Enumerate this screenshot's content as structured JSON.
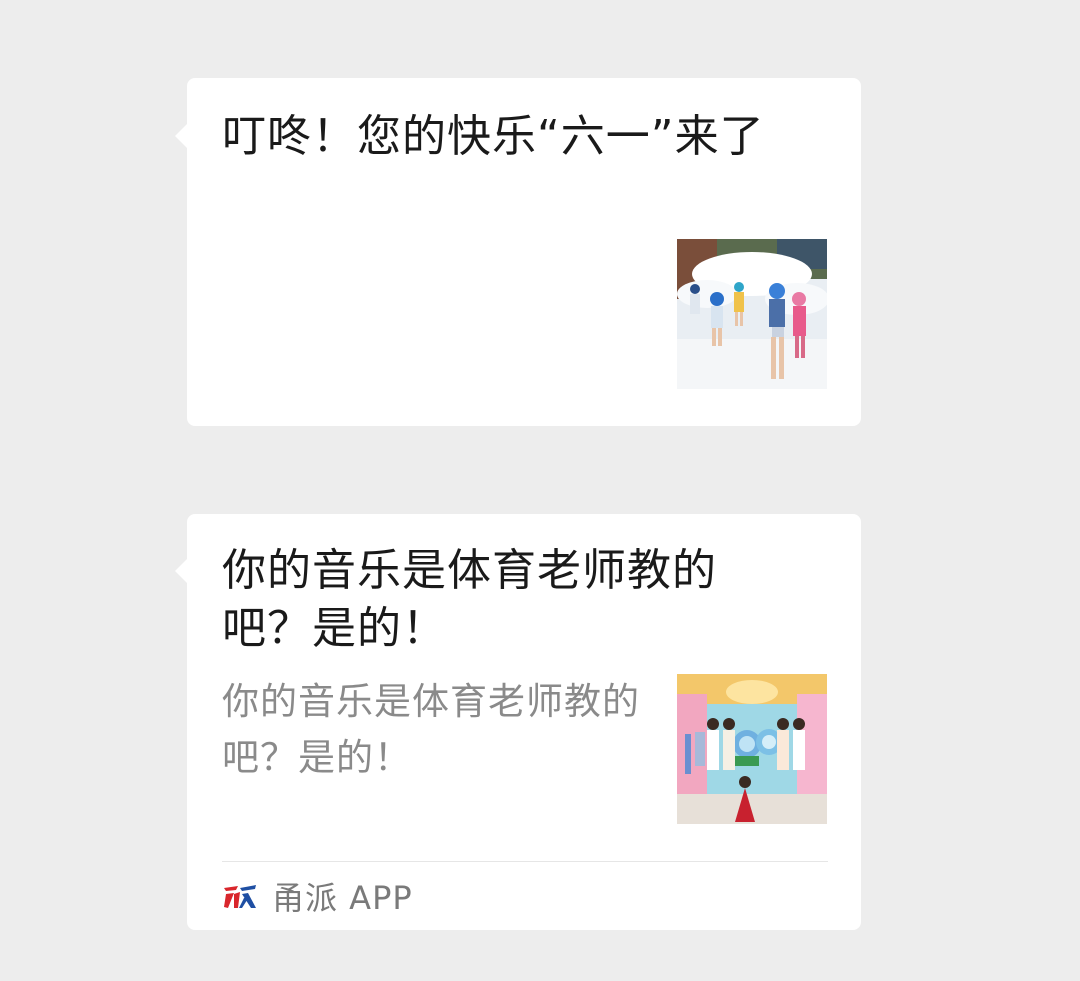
{
  "messages": [
    {
      "title": "叮咚！您的快乐“六一”来了",
      "thumbnail_icon": "photo-children-foam-party"
    },
    {
      "title": "你的音乐是体育老师教的吧？是的！",
      "description": "你的音乐是体育老师教的吧？是的！",
      "thumbnail_icon": "photo-children-stage-performance",
      "source": {
        "icon": "yongpai-logo",
        "name": "甬派 APP"
      }
    }
  ],
  "colors": {
    "background": "#ededed",
    "card": "#ffffff",
    "title_text": "#1a1a1a",
    "secondary_text": "#8a8a8a",
    "logo_red": "#d9262c",
    "logo_blue": "#1f4fa3"
  }
}
